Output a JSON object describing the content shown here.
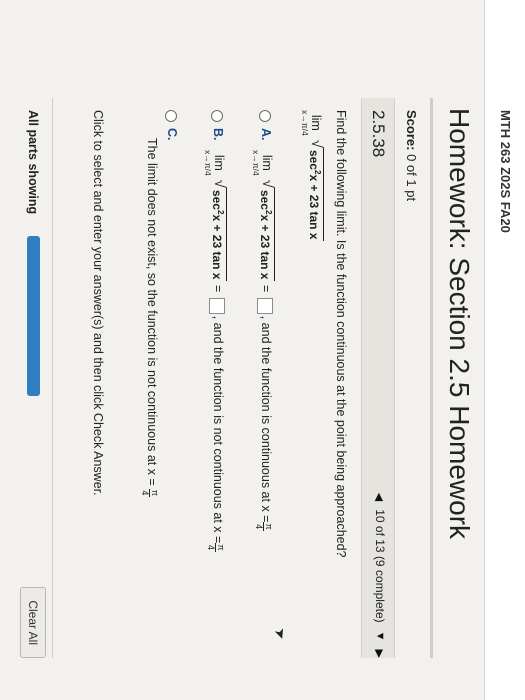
{
  "header": {
    "course": "MTH 263 Z02S FA20"
  },
  "title": "Homework: Section 2.5 Homework",
  "score": {
    "label": "Score:",
    "value": "0 of 1 pt"
  },
  "question": {
    "number": "2.5.38",
    "nav_text": "10 of 13 (9 complete)",
    "prompt": "Find the following limit. Is the function continuous at the point being approached?",
    "lim_word": "lim",
    "lim_sub": "x→π/4",
    "expr_sec": "sec",
    "expr_pow": "2",
    "expr_rest": "x + 23 tan x",
    "expr_rest_bold": "x + 23 tan x",
    "equals": " = ",
    "pi": "π",
    "four": "4"
  },
  "options": {
    "a": {
      "label": "A.",
      "tail": ", and the function is continuous at x ="
    },
    "b": {
      "label": "B.",
      "tail": ", and the function is not continuous at x ="
    },
    "c": {
      "label": "C.",
      "text": "The limit does not exist, so the function is not continuous at x ="
    }
  },
  "instruction": "Click to select and enter your answer(s) and then click Check Answer.",
  "footer": {
    "all_parts": "All parts showing",
    "progress": 1.0,
    "clear_all": "Clear All"
  },
  "colors": {
    "accent": "#2f7fc0",
    "option_label": "#1f4e8c"
  }
}
